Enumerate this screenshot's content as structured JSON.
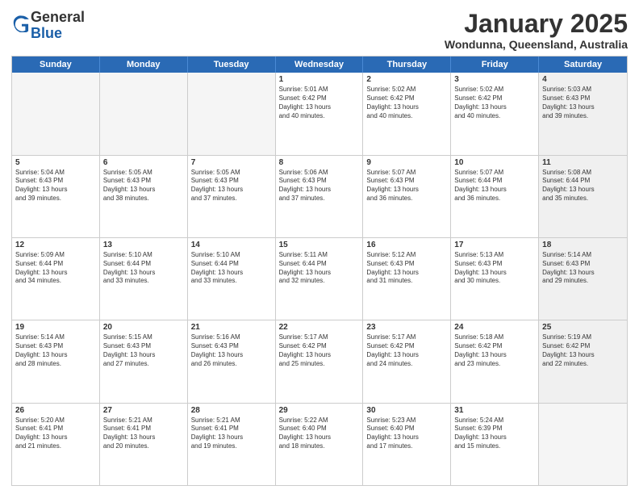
{
  "logo": {
    "general": "General",
    "blue": "Blue"
  },
  "title": "January 2025",
  "location": "Wondunna, Queensland, Australia",
  "days": [
    "Sunday",
    "Monday",
    "Tuesday",
    "Wednesday",
    "Thursday",
    "Friday",
    "Saturday"
  ],
  "weeks": [
    [
      {
        "num": "",
        "text": "",
        "empty": true
      },
      {
        "num": "",
        "text": "",
        "empty": true
      },
      {
        "num": "",
        "text": "",
        "empty": true
      },
      {
        "num": "1",
        "text": "Sunrise: 5:01 AM\nSunset: 6:42 PM\nDaylight: 13 hours\nand 40 minutes."
      },
      {
        "num": "2",
        "text": "Sunrise: 5:02 AM\nSunset: 6:42 PM\nDaylight: 13 hours\nand 40 minutes."
      },
      {
        "num": "3",
        "text": "Sunrise: 5:02 AM\nSunset: 6:42 PM\nDaylight: 13 hours\nand 40 minutes."
      },
      {
        "num": "4",
        "text": "Sunrise: 5:03 AM\nSunset: 6:43 PM\nDaylight: 13 hours\nand 39 minutes.",
        "shaded": true
      }
    ],
    [
      {
        "num": "5",
        "text": "Sunrise: 5:04 AM\nSunset: 6:43 PM\nDaylight: 13 hours\nand 39 minutes."
      },
      {
        "num": "6",
        "text": "Sunrise: 5:05 AM\nSunset: 6:43 PM\nDaylight: 13 hours\nand 38 minutes."
      },
      {
        "num": "7",
        "text": "Sunrise: 5:05 AM\nSunset: 6:43 PM\nDaylight: 13 hours\nand 37 minutes."
      },
      {
        "num": "8",
        "text": "Sunrise: 5:06 AM\nSunset: 6:43 PM\nDaylight: 13 hours\nand 37 minutes."
      },
      {
        "num": "9",
        "text": "Sunrise: 5:07 AM\nSunset: 6:43 PM\nDaylight: 13 hours\nand 36 minutes."
      },
      {
        "num": "10",
        "text": "Sunrise: 5:07 AM\nSunset: 6:44 PM\nDaylight: 13 hours\nand 36 minutes."
      },
      {
        "num": "11",
        "text": "Sunrise: 5:08 AM\nSunset: 6:44 PM\nDaylight: 13 hours\nand 35 minutes.",
        "shaded": true
      }
    ],
    [
      {
        "num": "12",
        "text": "Sunrise: 5:09 AM\nSunset: 6:44 PM\nDaylight: 13 hours\nand 34 minutes."
      },
      {
        "num": "13",
        "text": "Sunrise: 5:10 AM\nSunset: 6:44 PM\nDaylight: 13 hours\nand 33 minutes."
      },
      {
        "num": "14",
        "text": "Sunrise: 5:10 AM\nSunset: 6:44 PM\nDaylight: 13 hours\nand 33 minutes."
      },
      {
        "num": "15",
        "text": "Sunrise: 5:11 AM\nSunset: 6:44 PM\nDaylight: 13 hours\nand 32 minutes."
      },
      {
        "num": "16",
        "text": "Sunrise: 5:12 AM\nSunset: 6:43 PM\nDaylight: 13 hours\nand 31 minutes."
      },
      {
        "num": "17",
        "text": "Sunrise: 5:13 AM\nSunset: 6:43 PM\nDaylight: 13 hours\nand 30 minutes."
      },
      {
        "num": "18",
        "text": "Sunrise: 5:14 AM\nSunset: 6:43 PM\nDaylight: 13 hours\nand 29 minutes.",
        "shaded": true
      }
    ],
    [
      {
        "num": "19",
        "text": "Sunrise: 5:14 AM\nSunset: 6:43 PM\nDaylight: 13 hours\nand 28 minutes."
      },
      {
        "num": "20",
        "text": "Sunrise: 5:15 AM\nSunset: 6:43 PM\nDaylight: 13 hours\nand 27 minutes."
      },
      {
        "num": "21",
        "text": "Sunrise: 5:16 AM\nSunset: 6:43 PM\nDaylight: 13 hours\nand 26 minutes."
      },
      {
        "num": "22",
        "text": "Sunrise: 5:17 AM\nSunset: 6:42 PM\nDaylight: 13 hours\nand 25 minutes."
      },
      {
        "num": "23",
        "text": "Sunrise: 5:17 AM\nSunset: 6:42 PM\nDaylight: 13 hours\nand 24 minutes."
      },
      {
        "num": "24",
        "text": "Sunrise: 5:18 AM\nSunset: 6:42 PM\nDaylight: 13 hours\nand 23 minutes."
      },
      {
        "num": "25",
        "text": "Sunrise: 5:19 AM\nSunset: 6:42 PM\nDaylight: 13 hours\nand 22 minutes.",
        "shaded": true
      }
    ],
    [
      {
        "num": "26",
        "text": "Sunrise: 5:20 AM\nSunset: 6:41 PM\nDaylight: 13 hours\nand 21 minutes."
      },
      {
        "num": "27",
        "text": "Sunrise: 5:21 AM\nSunset: 6:41 PM\nDaylight: 13 hours\nand 20 minutes."
      },
      {
        "num": "28",
        "text": "Sunrise: 5:21 AM\nSunset: 6:41 PM\nDaylight: 13 hours\nand 19 minutes."
      },
      {
        "num": "29",
        "text": "Sunrise: 5:22 AM\nSunset: 6:40 PM\nDaylight: 13 hours\nand 18 minutes."
      },
      {
        "num": "30",
        "text": "Sunrise: 5:23 AM\nSunset: 6:40 PM\nDaylight: 13 hours\nand 17 minutes."
      },
      {
        "num": "31",
        "text": "Sunrise: 5:24 AM\nSunset: 6:39 PM\nDaylight: 13 hours\nand 15 minutes."
      },
      {
        "num": "",
        "text": "",
        "empty": true,
        "shaded": true
      }
    ]
  ]
}
